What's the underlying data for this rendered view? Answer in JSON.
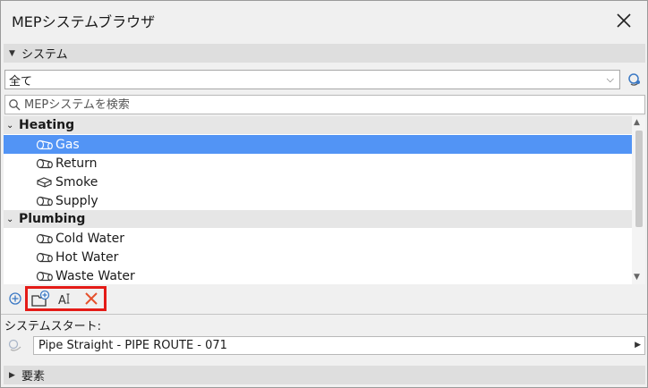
{
  "window": {
    "title": "MEPシステムブラウザ"
  },
  "system_section": {
    "label": "システム"
  },
  "filter": {
    "value": "全て"
  },
  "search": {
    "placeholder": "MEPシステムを検索"
  },
  "tree": {
    "groups": [
      {
        "label": "Heating",
        "items": [
          {
            "label": "Gas",
            "selected": true,
            "icon": "pipe-icon"
          },
          {
            "label": "Return",
            "icon": "pipe-icon"
          },
          {
            "label": "Smoke",
            "icon": "duct-icon"
          },
          {
            "label": "Supply",
            "icon": "pipe-icon"
          }
        ]
      },
      {
        "label": "Plumbing",
        "items": [
          {
            "label": "Cold Water",
            "icon": "pipe-icon"
          },
          {
            "label": "Hot Water",
            "icon": "pipe-icon"
          },
          {
            "label": "Waste Water",
            "icon": "pipe-icon"
          }
        ]
      }
    ]
  },
  "toolbar": {
    "buttons": [
      "add-system-icon",
      "new-folder-icon",
      "rename-icon",
      "delete-icon"
    ]
  },
  "system_start": {
    "label": "システムスタート:",
    "value": "Pipe Straight - PIPE ROUTE - 071"
  },
  "elements_section": {
    "label": "要素"
  },
  "colors": {
    "selection": "#5294f5",
    "highlight": "#e41b17",
    "delete": "#e5502c"
  }
}
